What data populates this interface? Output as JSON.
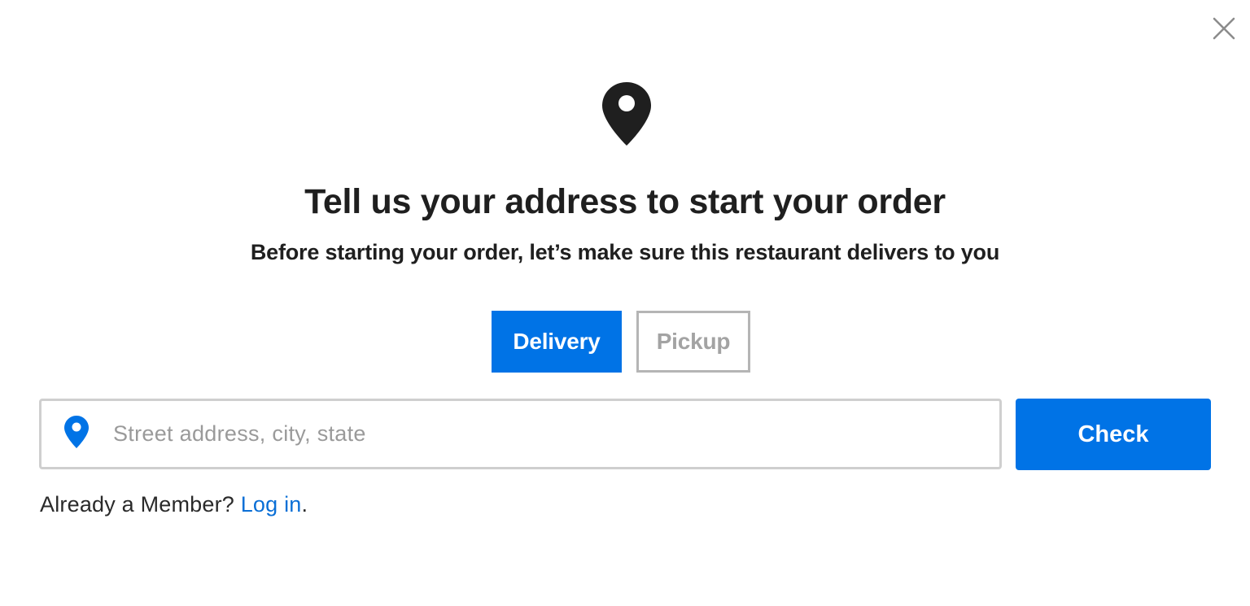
{
  "icons": {
    "close": "close-icon",
    "hero": "map-pin-icon",
    "address": "map-pin-icon"
  },
  "colors": {
    "accent": "#0073e6",
    "link": "#0a6fd6",
    "text": "#1f1f1f",
    "muted": "#a3a3a3",
    "border": "#cfcfcf"
  },
  "header": {
    "title": "Tell us your address to start your order",
    "subtitle": "Before starting your order, let’s make sure this restaurant delivers to you"
  },
  "order_mode": {
    "selected": "Delivery",
    "options": [
      {
        "label": "Delivery"
      },
      {
        "label": "Pickup"
      }
    ]
  },
  "address": {
    "value": "",
    "placeholder": "Street address, city, state"
  },
  "check_button": {
    "label": "Check"
  },
  "member": {
    "prompt": "Already a Member?",
    "link_label": "Log in",
    "suffix": "."
  }
}
